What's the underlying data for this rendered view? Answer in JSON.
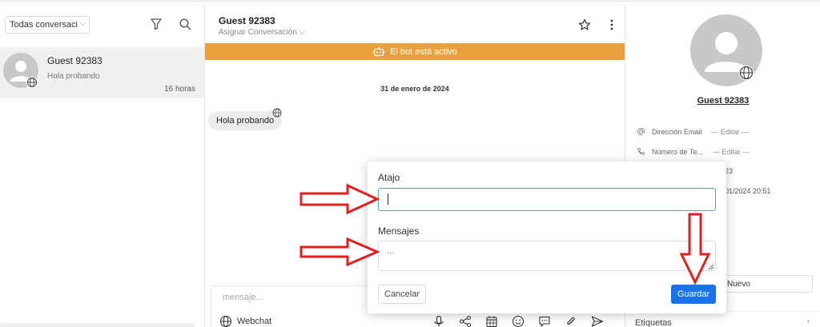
{
  "sidebar": {
    "filter_value": "Todas conversacio",
    "conversations": [
      {
        "name": "Guest 92383",
        "last_message": "Hola probando",
        "time": "16 horas"
      }
    ]
  },
  "chat": {
    "title": "Guest 92383",
    "assign_label": "Asignar Conversación",
    "bot_banner": "El bot está activo",
    "date_separator": "31 de enero de 2024",
    "messages": [
      {
        "text": "Hola probando"
      }
    ],
    "composer_placeholder": "mensaje...",
    "channel_label": "Webchat"
  },
  "contact": {
    "name": "Guest 92383",
    "email_label": "Dirección Email",
    "email_value": "— Editar —",
    "phone_label": "Número de Te...",
    "phone_value": "— Editar —",
    "partial_id": "23",
    "partial_date": "01/2024 20:51",
    "new_button": "Nuevo",
    "tags_label": "Etiquetas"
  },
  "modal": {
    "shortcut_label": "Atajo",
    "shortcut_value": "",
    "messages_label": "Mensajes",
    "messages_placeholder": "...",
    "cancel_label": "Cancelar",
    "save_label": "Guardar"
  },
  "colors": {
    "banner": "#e8a13c",
    "primary": "#1a73e8",
    "annotation_arrow": "#e02020"
  }
}
